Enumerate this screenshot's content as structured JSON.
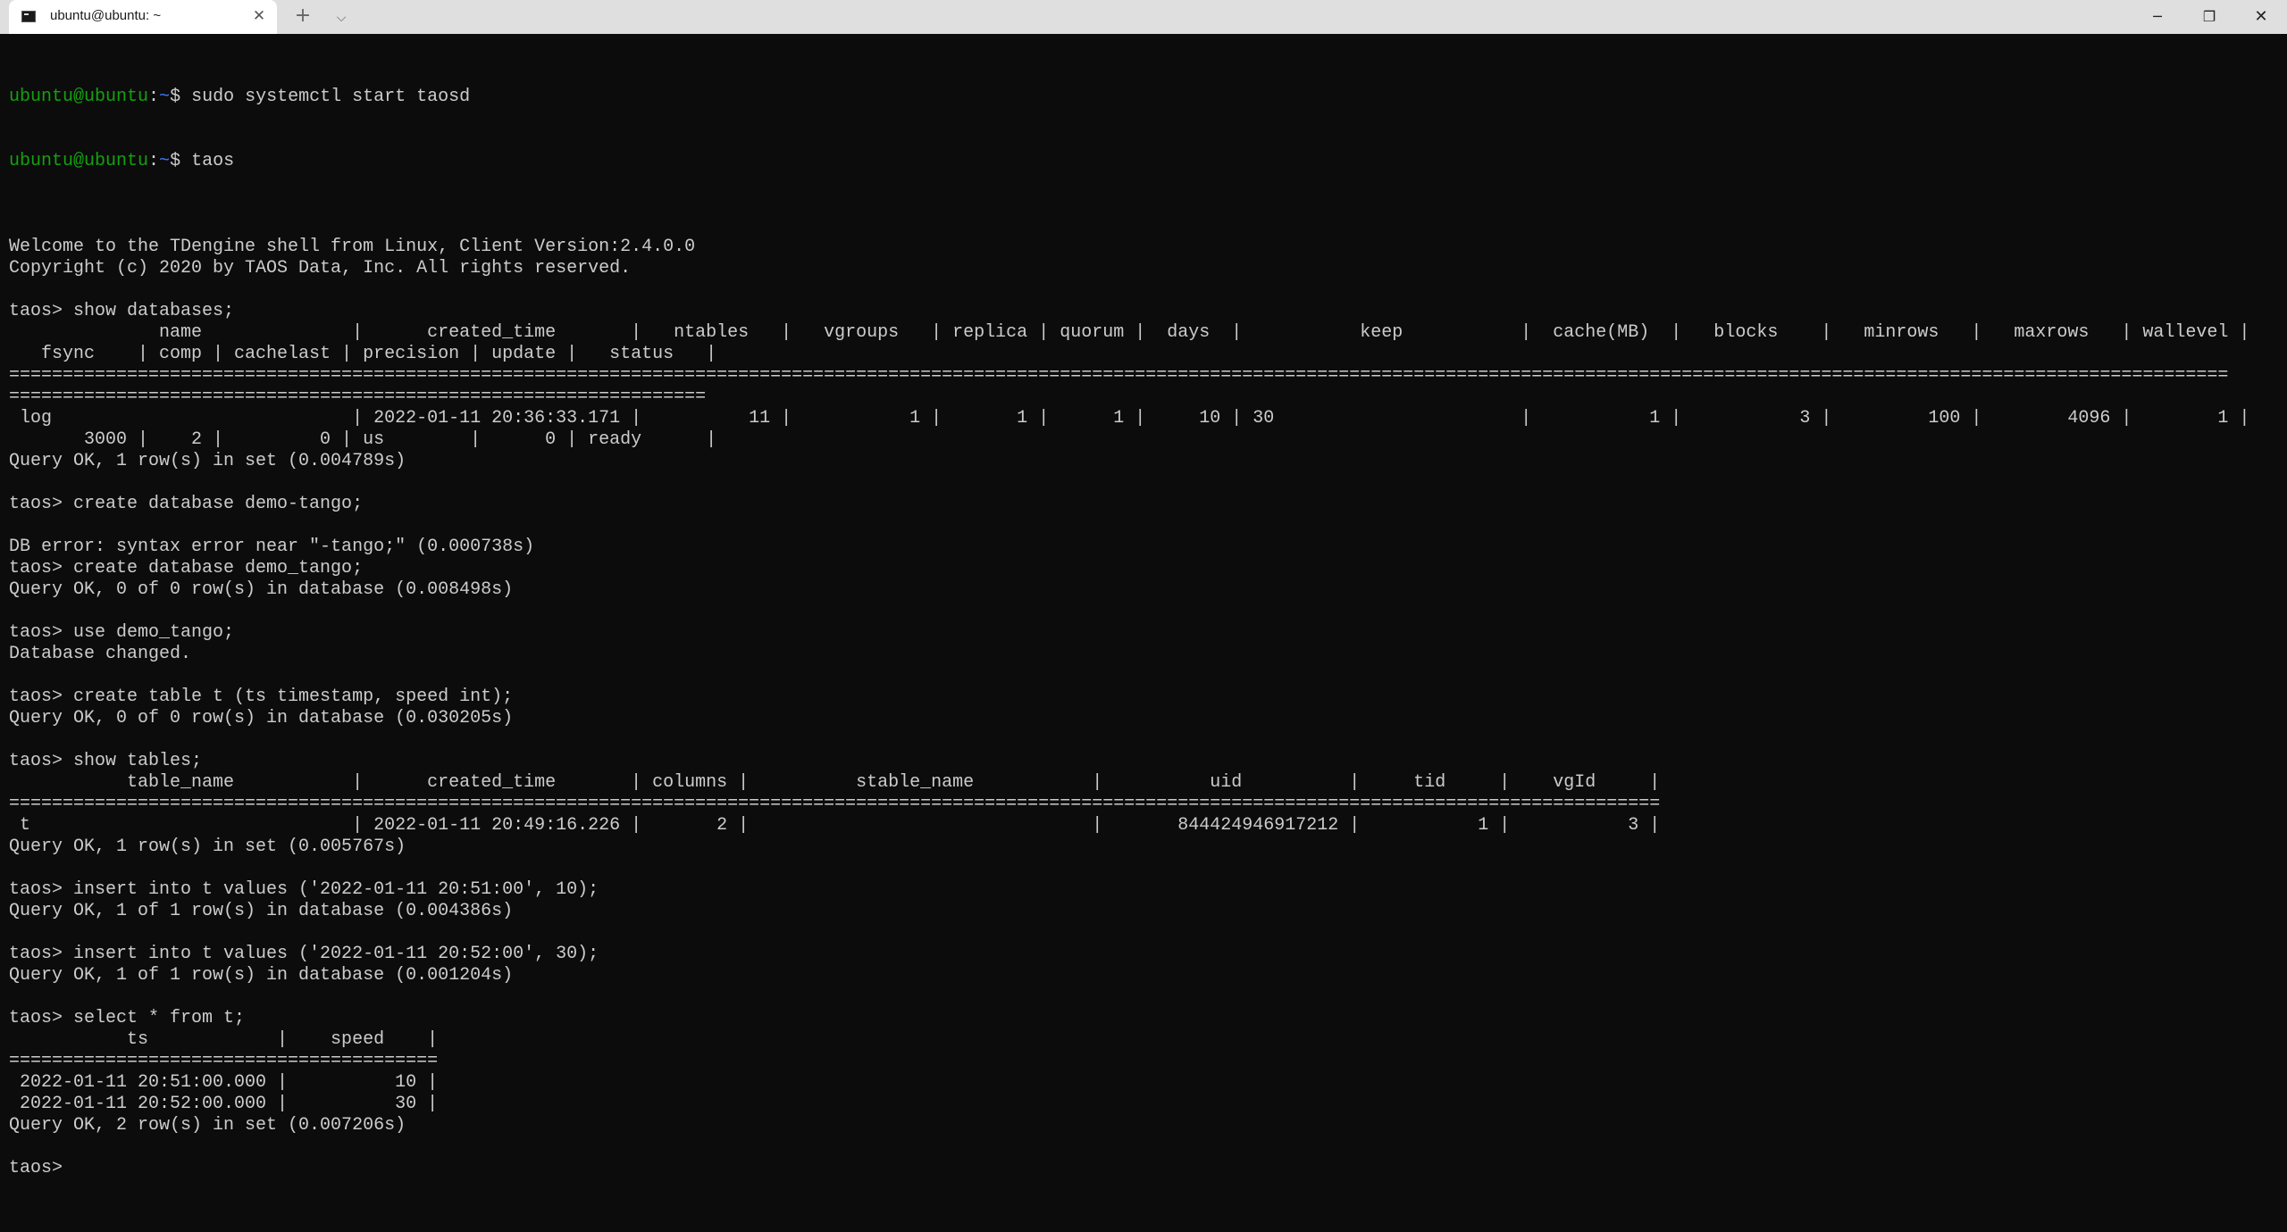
{
  "tab": {
    "title": "ubuntu@ubuntu: ~",
    "close_glyph": "✕",
    "new_tab_glyph": "+",
    "dropdown_glyph": "⌵"
  },
  "window_controls": {
    "minimize_glyph": "─",
    "maximize_glyph": "❐",
    "close_glyph": "✕"
  },
  "colors": {
    "background": "#0c0c0c",
    "text": "#cccccc",
    "prompt_user": "#13a10e",
    "prompt_path": "#3b78ff",
    "titlebar": "#dfdfdf"
  },
  "icons": {
    "tab": "terminal-icon"
  },
  "shell_prompt": {
    "user": "ubuntu@ubuntu",
    "sep": ":",
    "path": "~",
    "sym": "$ "
  },
  "terminal": {
    "lines": [
      "",
      "",
      "",
      "Welcome to the TDengine shell from Linux, Client Version:2.4.0.0",
      "Copyright (c) 2020 by TAOS Data, Inc. All rights reserved.",
      "",
      "taos> show databases;",
      "              name              |      created_time       |   ntables   |   vgroups   | replica | quorum |  days  |           keep           |  cache(MB)  |   blocks    |   minrows   |   maxrows   | wallevel |",
      "   fsync    | comp | cachelast | precision | update |   status   |",
      "===============================================================================================================================================================================================================",
      "=================================================================",
      " log                            | 2022-01-11 20:36:33.171 |          11 |           1 |       1 |      1 |     10 | 30                       |           1 |           3 |         100 |        4096 |        1 |",
      "       3000 |    2 |         0 | us        |      0 | ready      |",
      "Query OK, 1 row(s) in set (0.004789s)",
      "",
      "taos> create database demo-tango;",
      "",
      "DB error: syntax error near \"-tango;\" (0.000738s)",
      "taos> create database demo_tango;",
      "Query OK, 0 of 0 row(s) in database (0.008498s)",
      "",
      "taos> use demo_tango;",
      "Database changed.",
      "",
      "taos> create table t (ts timestamp, speed int);",
      "Query OK, 0 of 0 row(s) in database (0.030205s)",
      "",
      "taos> show tables;",
      "           table_name           |      created_time       | columns |          stable_name           |          uid          |     tid     |    vgId     |",
      "==========================================================================================================================================================",
      " t                              | 2022-01-11 20:49:16.226 |       2 |                                |       844424946917212 |           1 |           3 |",
      "Query OK, 1 row(s) in set (0.005767s)",
      "",
      "taos> insert into t values ('2022-01-11 20:51:00', 10);",
      "Query OK, 1 of 1 row(s) in database (0.004386s)",
      "",
      "taos> insert into t values ('2022-01-11 20:52:00', 30);",
      "Query OK, 1 of 1 row(s) in database (0.001204s)",
      "",
      "taos> select * from t;",
      "           ts            |    speed    |",
      "========================================",
      " 2022-01-11 20:51:00.000 |          10 |",
      " 2022-01-11 20:52:00.000 |          30 |",
      "Query OK, 2 row(s) in set (0.007206s)",
      "",
      "taos> "
    ],
    "prompt_commands": [
      "sudo systemctl start taosd",
      "taos"
    ]
  }
}
